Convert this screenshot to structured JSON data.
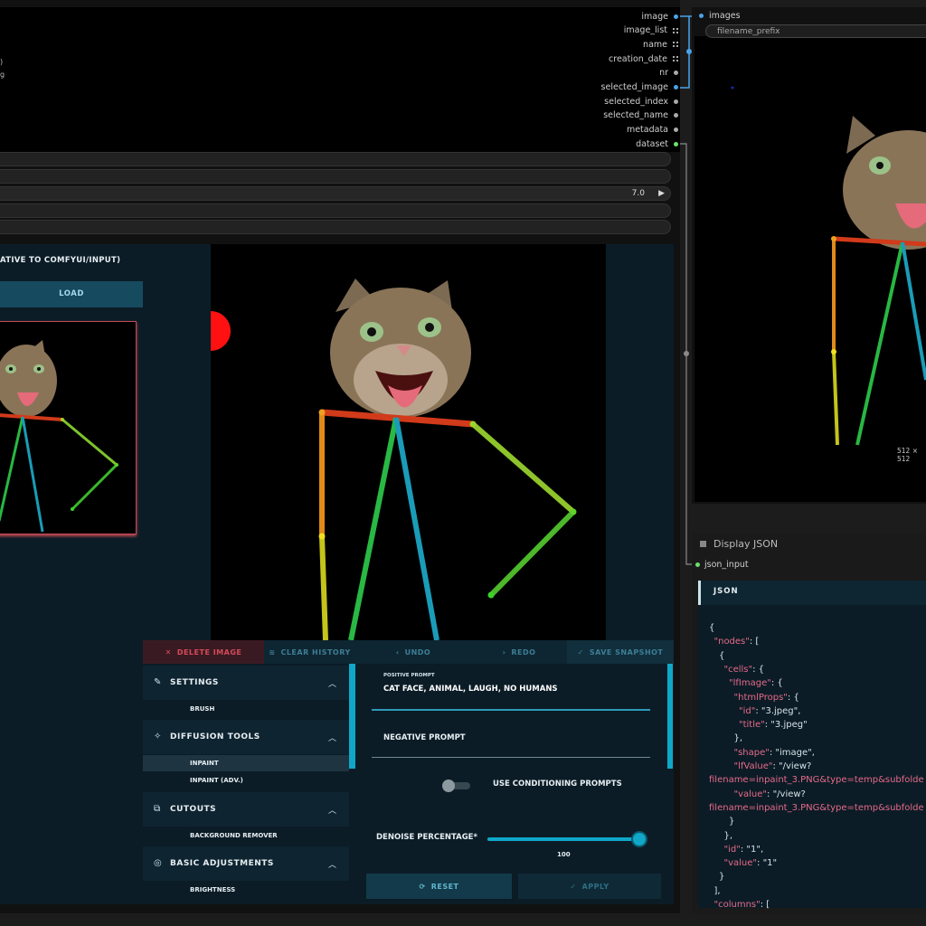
{
  "left_node": {
    "outputs": [
      {
        "label": "image",
        "kind": "dot",
        "color": "#4aa3e8"
      },
      {
        "label": "image_list",
        "kind": "grid",
        "color": "#4aa3e8"
      },
      {
        "label": "name",
        "kind": "grid",
        "color": "#aaaaaa"
      },
      {
        "label": "creation_date",
        "kind": "grid",
        "color": "#aaaaaa"
      },
      {
        "label": "nr",
        "kind": "dot",
        "color": "#aaaaaa"
      },
      {
        "label": "selected_image",
        "kind": "dot",
        "color": "#4aa3e8"
      },
      {
        "label": "selected_index",
        "kind": "dot",
        "color": "#aaaaaa"
      },
      {
        "label": "selected_name",
        "kind": "dot",
        "color": "#aaaaaa"
      },
      {
        "label": "metadata",
        "kind": "dot",
        "color": "#aaaaaa"
      },
      {
        "label": "dataset",
        "kind": "dot",
        "color": "#6de06d"
      }
    ],
    "widget_value": "7.0",
    "widget_arrow": "▶"
  },
  "lf_widget": {
    "title": "ATIVE TO COMFYUI/INPUT)",
    "load_label": "LOAD",
    "toolbar": {
      "delete": "DELETE IMAGE",
      "clear": "CLEAR HISTORY",
      "undo": "UNDO",
      "redo": "REDO",
      "snapshot": "SAVE SNAPSHOT"
    },
    "sections": [
      {
        "label": "SETTINGS",
        "icon": "brush-icon",
        "glyph": "✎",
        "items": [
          "BRUSH"
        ]
      },
      {
        "label": "DIFFUSION TOOLS",
        "icon": "wand-icon",
        "glyph": "✧",
        "items": [
          "INPAINT",
          "INPAINT (ADV.)"
        ]
      },
      {
        "label": "CUTOUTS",
        "icon": "cutout-icon",
        "glyph": "⧉",
        "items": [
          "BACKGROUND REMOVER"
        ]
      },
      {
        "label": "BASIC ADJUSTMENTS",
        "icon": "adjust-icon",
        "glyph": "◎",
        "items": [
          "BRIGHTNESS"
        ]
      }
    ],
    "selected_item": "INPAINT",
    "positive_prompt_label": "POSITIVE PROMPT",
    "positive_prompt": "CAT FACE, ANIMAL, LAUGH, NO HUMANS",
    "negative_prompt": "NEGATIVE PROMPT",
    "use_conditioning": "USE CONDITIONING PROMPTS",
    "denoise_label": "DENOISE PERCENTAGE*",
    "denoise_value": "100",
    "denoise_fraction": 1.0,
    "reset": "RESET",
    "apply": "APPLY"
  },
  "right_node": {
    "input_label": "images",
    "filename_placeholder": "filename_prefix",
    "size_label": "512 × 512"
  },
  "json_node": {
    "title": "Display JSON",
    "input_label": "json_input",
    "panel_header": "JSON",
    "lines": [
      {
        "k": "",
        "v": "{",
        "indent": 0
      },
      {
        "k": "\"nodes\"",
        "v": ": [",
        "indent": 1
      },
      {
        "k": "",
        "v": "{",
        "indent": 2
      },
      {
        "k": "\"cells\"",
        "v": ": {",
        "indent": 3
      },
      {
        "k": "\"lfImage\"",
        "v": ": {",
        "indent": 4
      },
      {
        "k": "\"htmlProps\"",
        "v": ": {",
        "indent": 5
      },
      {
        "k": "\"id\"",
        "v": ": \"3.jpeg\",",
        "indent": 6
      },
      {
        "k": "\"title\"",
        "v": ": \"3.jpeg\"",
        "indent": 6
      },
      {
        "k": "",
        "v": "},",
        "indent": 5
      },
      {
        "k": "\"shape\"",
        "v": ": \"image\",",
        "indent": 5
      },
      {
        "k": "\"lfValue\"",
        "v": ": \"/view?",
        "indent": 5
      },
      {
        "k": "",
        "v": "filename=inpaint_3.PNG&type=temp&subfolde",
        "indent": 0
      },
      {
        "k": "\"value\"",
        "v": ": \"/view?",
        "indent": 5
      },
      {
        "k": "",
        "v": "filename=inpaint_3.PNG&type=temp&subfolde",
        "indent": 0
      },
      {
        "k": "",
        "v": "}",
        "indent": 4
      },
      {
        "k": "",
        "v": "},",
        "indent": 3
      },
      {
        "k": "\"id\"",
        "v": ": \"1\",",
        "indent": 3
      },
      {
        "k": "\"value\"",
        "v": ": \"1\"",
        "indent": 3
      },
      {
        "k": "",
        "v": "}",
        "indent": 2
      },
      {
        "k": "",
        "v": "],",
        "indent": 1
      },
      {
        "k": "\"columns\"",
        "v": ": [",
        "indent": 1
      }
    ]
  }
}
